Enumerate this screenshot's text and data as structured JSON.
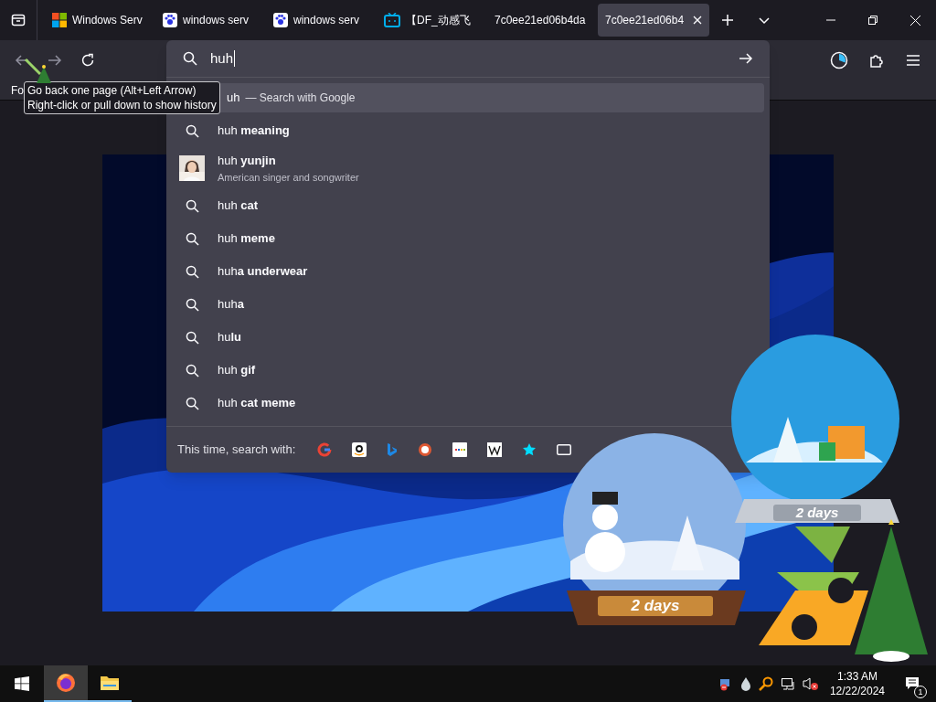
{
  "tabs": [
    {
      "kind": "windows",
      "title": "Windows Serv",
      "selected": false
    },
    {
      "kind": "paw",
      "title": "windows serv",
      "selected": false
    },
    {
      "kind": "paw",
      "title": "windows serv",
      "selected": false
    },
    {
      "kind": "tv",
      "title": "【DF_动感飞",
      "selected": false
    },
    {
      "kind": "none",
      "title": "7c0ee21ed06b4da",
      "selected": false
    },
    {
      "kind": "none",
      "title": "7c0ee21ed06b4",
      "selected": true
    }
  ],
  "address_bar": {
    "value": "huh"
  },
  "bookmarks_bar": {
    "items": [
      "Fo"
    ]
  },
  "tooltip": {
    "lines": [
      "Go back one page (Alt+Left Arrow)",
      "Right-click or pull down to show history"
    ]
  },
  "suggestions": [
    {
      "kind": "search",
      "text": "uh",
      "action": "— Search with Google",
      "selected": true
    },
    {
      "kind": "search",
      "text": "huh **meaning**",
      "selected": false
    },
    {
      "kind": "entity",
      "text": "huh **yunjin**",
      "description": "American singer and songwriter",
      "selected": false
    },
    {
      "kind": "search",
      "text": "huh **cat**",
      "selected": false
    },
    {
      "kind": "search",
      "text": "huh **meme**",
      "selected": false
    },
    {
      "kind": "search",
      "text": "huh**a underwear**",
      "selected": false
    },
    {
      "kind": "search",
      "text": "huh**a**",
      "selected": false
    },
    {
      "kind": "search",
      "text": "hu**lu**",
      "selected": false
    },
    {
      "kind": "search",
      "text": "huh **gif**",
      "selected": false
    },
    {
      "kind": "search",
      "text": "huh **cat meme**",
      "selected": false
    }
  ],
  "search_with": {
    "label": "This time, search with:"
  },
  "widgets": [
    {
      "label": "2 days"
    },
    {
      "label": "2 days"
    }
  ],
  "taskbar": {
    "apps": [
      {
        "kind": "firefox",
        "active": true
      },
      {
        "kind": "explorer",
        "active": false
      }
    ],
    "time": "1:33 AM",
    "date": "12/22/2024",
    "notifications": "1"
  }
}
